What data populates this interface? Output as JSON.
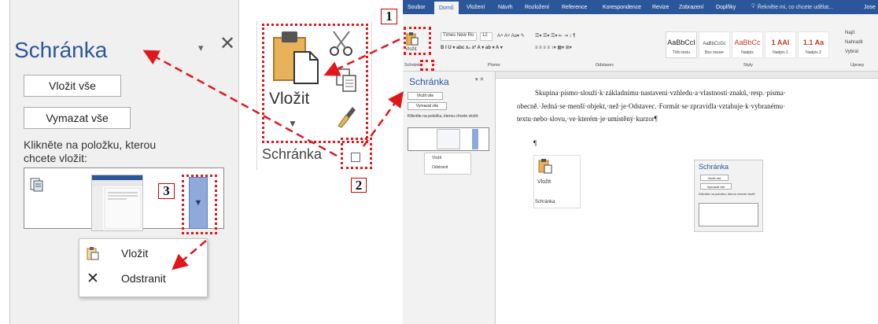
{
  "clipboard_pane": {
    "title": "Schránka",
    "pin_glyph": "▾",
    "close_glyph": "✕",
    "paste_all_label": "Vložit vše",
    "clear_all_label": "Vymazat vše",
    "hint_line1": "Klikněte na položku, kterou",
    "hint_line2": "chcete vložit:",
    "item_menu": {
      "paste_label": "Vložit",
      "delete_label": "Odstranit"
    }
  },
  "ribbon_group_zoom": {
    "paste_label": "Vložit",
    "group_label": "Schránka"
  },
  "callouts": [
    "1",
    "2",
    "3"
  ],
  "word": {
    "tabs": [
      "Soubor",
      "Domů",
      "Vložení",
      "Návrh",
      "Rozložení",
      "Reference",
      "Korespondence",
      "Revize",
      "Zobrazení",
      "Doplňky"
    ],
    "tell_me": "Řekněte mi, co chcete udělat...",
    "user": "Jose",
    "font_name": "Times New Ro",
    "font_size": "12",
    "groups": {
      "clipboard": "Schránka",
      "font": "Písmo",
      "paragraph": "Odstavec",
      "styles": "Styly",
      "editing": "Úpravy"
    },
    "paste_label": "Vložit",
    "styles": [
      {
        "preview": "AaBbCcI",
        "name": "Tělo textu"
      },
      {
        "preview": "AaBbCcDc",
        "name": "Bez mezer"
      },
      {
        "preview": "AaBbCc",
        "name": "Nadpis"
      },
      {
        "preview": "1 AAI",
        "name": "Nadpis 1"
      },
      {
        "preview": "1.1 Aa",
        "name": "Nadpis 2"
      }
    ],
    "editing": [
      "Najít",
      "Nahradit",
      "Vybrat"
    ],
    "pane": {
      "title": "Schránka",
      "paste_all": "Vložit vše",
      "clear_all": "Vymazat vše",
      "hint": "Klikněte na položku, kterou chcete vložit:",
      "menu_paste": "Vložit",
      "menu_delete": "Odstranit"
    },
    "doc_text_1": "Skupina·písmo·slouží·k·základnímu·nastavení·vzhledu·a·vlastností·znaků,·resp.·písma·",
    "doc_text_2": "obecně.·Jedná·se·menší·objekt,·než·je·Odstavec.·Formát·se·zpravidla·vztahuje·k·vybranému·",
    "doc_text_3": "textu·nebo·slovu,·ve·kterém·je·umístěný·kurzor¶",
    "pilcrow": "¶",
    "embed_group": {
      "paste": "Vložit",
      "label": "Schránka"
    },
    "embed_pane": {
      "title": "Schránka",
      "paste_all": "Vložit vše",
      "clear_all": "Vymazat vše",
      "hint": "Klikněte na položku, kterou chcete vložit:"
    }
  },
  "colors": {
    "accent": "#2b579a",
    "callout_red": "#e0171b",
    "dropdown_blue": "#8eaadb"
  }
}
